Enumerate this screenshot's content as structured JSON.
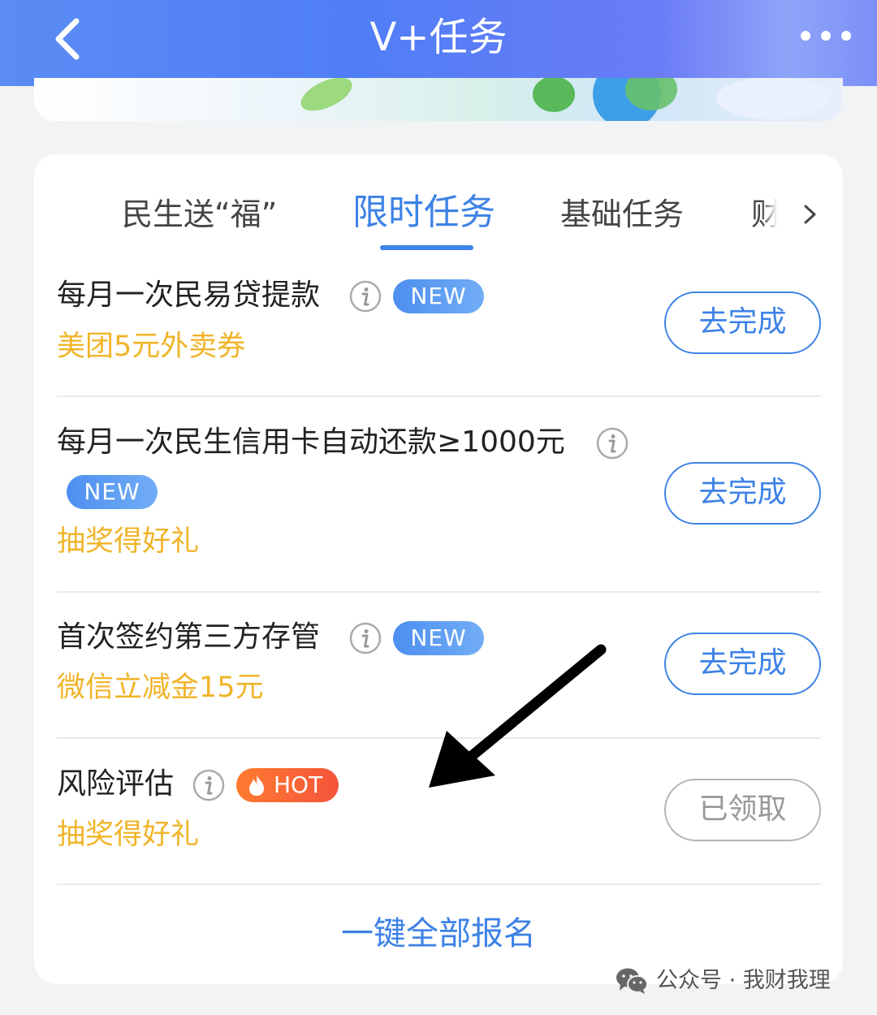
{
  "header": {
    "title": "V+任务"
  },
  "tabs": [
    {
      "label": "民生送“福”"
    },
    {
      "label": "限时任务",
      "active": true
    },
    {
      "label": "基础任务"
    },
    {
      "label": "财"
    }
  ],
  "tasks": [
    {
      "title": "每月一次民易贷提款",
      "badge": "NEW",
      "reward": "美团5元外卖券",
      "action": "去完成"
    },
    {
      "title": "每月一次民生信用卡自动还款≥1000元",
      "badge": "NEW",
      "reward": "抽奖得好礼",
      "action": "去完成"
    },
    {
      "title": "首次签约第三方存管",
      "badge": "NEW",
      "reward": "微信立减金15元",
      "action": "去完成"
    },
    {
      "title": "风险评估",
      "badge": "HOT",
      "reward": "抽奖得好礼",
      "action": "已领取"
    }
  ],
  "footer": {
    "enroll_all": "一键全部报名"
  },
  "watermark": {
    "text": "公众号 · 我财我理"
  },
  "colors": {
    "accent": "#3d82e6",
    "reward": "#f0b428",
    "hot": "#f5553b",
    "header": "#4f7ef6"
  },
  "icons": [
    "back-arrow-icon",
    "more-dots-icon",
    "chevron-right-icon",
    "info-icon",
    "flame-icon",
    "wechat-icon"
  ]
}
